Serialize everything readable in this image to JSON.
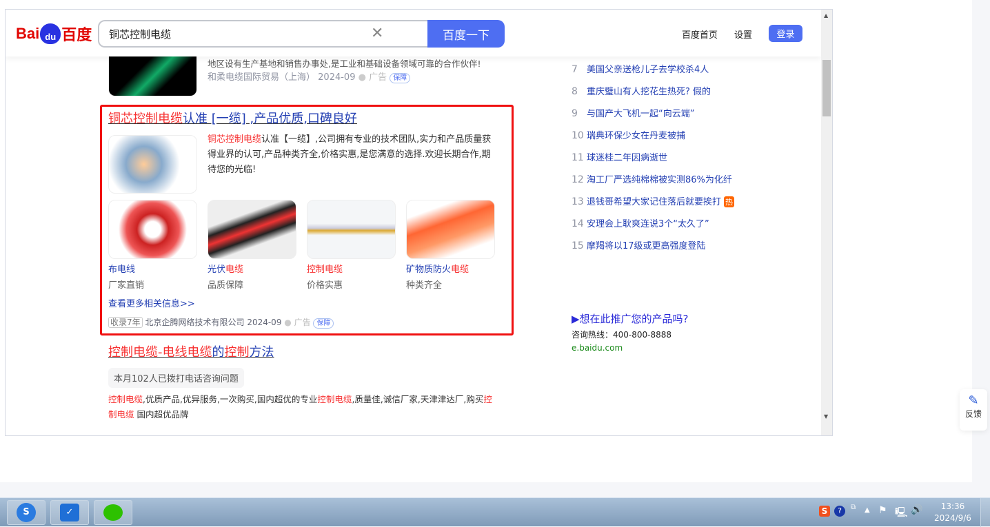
{
  "header": {
    "logo": "Bai du 百度",
    "query": "铜芯控制电缆",
    "search_button": "百度一下",
    "home_link": "百度首页",
    "settings_link": "设置",
    "login_button": "登录"
  },
  "prev_result": {
    "desc_cut": "地区设有生产基地和销售办事处,是工业和基础设备领域可靠的合作伙伴!",
    "source": "和柔电缆国际贸易（上海）",
    "date": "2024-09",
    "ad": "广告",
    "badge": "保障"
  },
  "ad_result": {
    "title_red": "铜芯控制电缆",
    "title_rest": "认准 [一缆] ,产品优质,口碑良好",
    "desc_red": "铜芯控制电缆",
    "desc_rest": "认准【一缆】,公司拥有专业的技术团队,实力和产品质量获得业界的认可,产品种类齐全,价格实惠,是您满意的选择.欢迎长期合作,期待您的光临!",
    "products": [
      {
        "name_blue": "布电线",
        "name_red": "",
        "sub": "厂家直销"
      },
      {
        "name_blue": "光伏",
        "name_red": "电缆",
        "sub": "品质保障"
      },
      {
        "name_blue": "",
        "name_red": "控制电缆",
        "sub": "价格实惠"
      },
      {
        "name_blue": "矿物质防火",
        "name_red": "电缆",
        "sub": "种类齐全"
      }
    ],
    "more": "查看更多相关信息>>",
    "years": "收录7年",
    "source": "北京企腾网络技术有限公司",
    "date": "2024-09",
    "ad": "广告",
    "badge": "保障"
  },
  "third_result": {
    "title_red1": "控制电缆-电线电缆",
    "title_blue1": "的",
    "title_red2": "控制",
    "title_blue2": "方法",
    "tag": "本月102人已拨打电话咨询问题",
    "desc": [
      {
        "t": "控制电缆",
        "r": true
      },
      {
        "t": ",优质产品,优异服务,一次购买,国内超优的专业",
        "r": false
      },
      {
        "t": "控制电缆",
        "r": true
      },
      {
        "t": ",质量佳,诚信厂家,天津津达厂,购买",
        "r": false
      },
      {
        "t": "控制电缆",
        "r": true
      },
      {
        "t": " 国内超优品牌",
        "r": false
      }
    ]
  },
  "hot_list": [
    {
      "n": "7",
      "t": "美国父亲送枪儿子去学校杀4人"
    },
    {
      "n": "8",
      "t": "重庆璧山有人挖花生热死? 假的"
    },
    {
      "n": "9",
      "t": "与国产大飞机一起“向云端”"
    },
    {
      "n": "10",
      "t": "瑞典环保少女在丹麦被捕"
    },
    {
      "n": "11",
      "t": "球迷桂二年因病逝世"
    },
    {
      "n": "12",
      "t": "淘工厂严选纯棉棉被实测86%为化纤"
    },
    {
      "n": "13",
      "t": "退钱哥希望大家记住落后就要挨打",
      "badge": "热"
    },
    {
      "n": "14",
      "t": "安理会上耿爽连说3个“太久了”"
    },
    {
      "n": "15",
      "t": "摩羯将以17级或更高强度登陆"
    }
  ],
  "promo": {
    "title": "▶想在此推广您的产品吗?",
    "hotline": "咨询热线：400-800-8888",
    "url": "e.baidu.com"
  },
  "feedback": "反馈",
  "tray": {
    "time": "13:36",
    "date": "2024/9/6"
  },
  "colors": {
    "accent": "#4e6ef2",
    "highlight": "#f73131",
    "link": "#2440b3",
    "ad_border": "#f01010"
  }
}
